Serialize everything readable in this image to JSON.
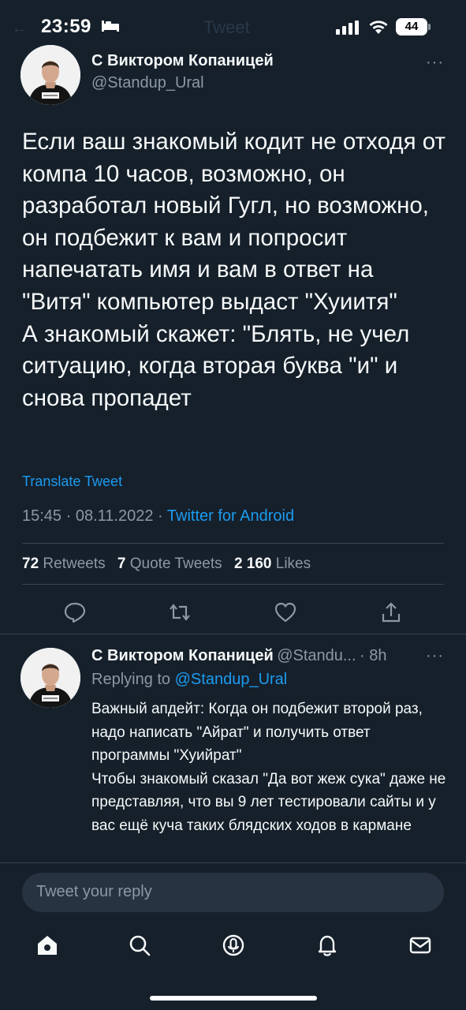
{
  "status_bar": {
    "time": "23:59",
    "battery": "44",
    "ghost_title": "Tweet"
  },
  "tweet": {
    "author_name": "С Виктором Копаницей",
    "author_handle": "@Standup_Ural",
    "more": "···",
    "text": "Если ваш знакомый кодит не отходя от компа 10 часов, возможно, он разработал новый Гугл, но возможно, он подбежит к вам и попросит напечатать имя и вам в ответ на \"Витя\" компьютер выдаст \"Хуиитя\"\nА знакомый скажет: \"Блять, не учел ситуацию, когда вторая буква \"и\" и снова пропадет",
    "translate_label": "Translate Tweet",
    "time": "15:45",
    "date": "08.11.2022",
    "separator": "·",
    "source": "Twitter for Android",
    "stats": {
      "retweets_count": "72",
      "retweets_label": "Retweets",
      "quotes_count": "7",
      "quotes_label": "Quote Tweets",
      "likes_count": "2 160",
      "likes_label": "Likes"
    },
    "actions": [
      {
        "icon": "reply-icon"
      },
      {
        "icon": "retweet-icon"
      },
      {
        "icon": "like-icon"
      },
      {
        "icon": "share-icon"
      }
    ]
  },
  "reply": {
    "author_name": "С Виктором Копаницей",
    "author_handle": "@Standu...",
    "time_ago": "· 8h",
    "more": "···",
    "replying_to_label": "Replying to",
    "replying_to_handle": "@Standup_Ural",
    "text": "Важный апдейт: Когда он подбежит второй раз, надо написать \"Айрат\" и получить ответ программы \"Хуийрат\"\nЧтобы знакомый сказал \"Да вот жеж сука\" даже не представляя, что вы 9 лет тестировали сайты и у вас ещё куча таких блядских ходов в кармане"
  },
  "composer": {
    "placeholder": "Tweet your reply"
  },
  "bottom_nav": [
    {
      "icon": "home-icon"
    },
    {
      "icon": "search-icon"
    },
    {
      "icon": "spaces-icon"
    },
    {
      "icon": "notifications-icon"
    },
    {
      "icon": "messages-icon"
    }
  ],
  "colors": {
    "background": "#15202b",
    "accent": "#1d9bf0",
    "secondary_text": "#8b98a5",
    "divider": "#38444d",
    "composer_bg": "#273340"
  }
}
